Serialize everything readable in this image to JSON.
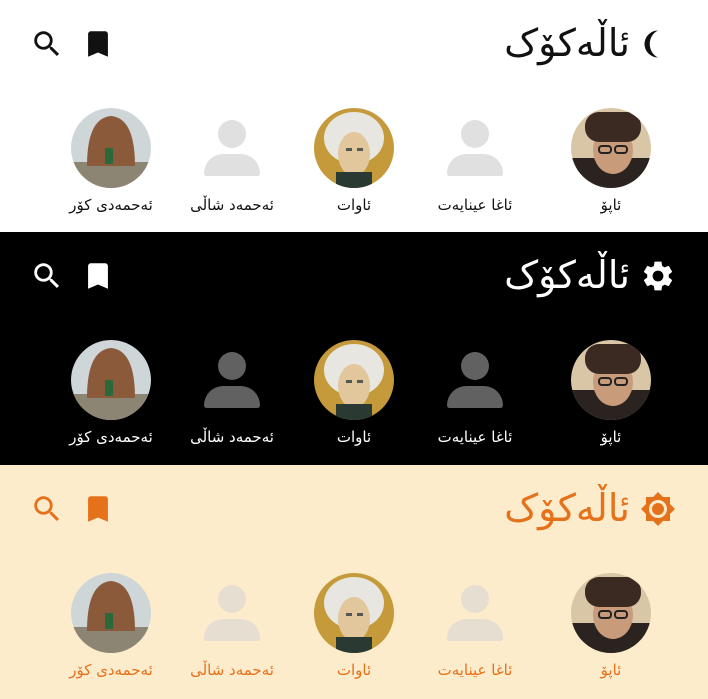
{
  "colors": {
    "light_bg": "#ffffff",
    "dark_bg": "#000000",
    "sepia_bg": "#fdeccc",
    "sepia_accent": "#e5711a"
  },
  "icons": {
    "search": "search-icon",
    "bookmark": "bookmark-icon",
    "theme_light": "moon-icon",
    "theme_dark": "gear-icon",
    "theme_sepia": "sun-icon"
  },
  "panels": [
    {
      "theme": "light",
      "title": "ئاڵەکۆک",
      "people": [
        {
          "name": "ئاپۆ",
          "avatar": "portrait-old-man-fur-hat"
        },
        {
          "name": "ئاغا عینایەت",
          "avatar": "placeholder"
        },
        {
          "name": "ئاوات",
          "avatar": "portrait-white-hair"
        },
        {
          "name": "ئەحمەد شاڵی",
          "avatar": "placeholder"
        },
        {
          "name": "ئەحمەدی کۆر",
          "avatar": "mud-dome-tomb"
        }
      ]
    },
    {
      "theme": "dark",
      "title": "ئاڵەکۆک",
      "people": [
        {
          "name": "ئاپۆ",
          "avatar": "portrait-old-man-fur-hat"
        },
        {
          "name": "ئاغا عینایەت",
          "avatar": "placeholder"
        },
        {
          "name": "ئاوات",
          "avatar": "portrait-white-hair"
        },
        {
          "name": "ئەحمەد شاڵی",
          "avatar": "placeholder"
        },
        {
          "name": "ئەحمەدی کۆر",
          "avatar": "mud-dome-tomb"
        }
      ]
    },
    {
      "theme": "sepia",
      "title": "ئاڵەکۆک",
      "people": [
        {
          "name": "ئاپۆ",
          "avatar": "portrait-old-man-fur-hat"
        },
        {
          "name": "ئاغا عینایەت",
          "avatar": "placeholder"
        },
        {
          "name": "ئاوات",
          "avatar": "portrait-white-hair"
        },
        {
          "name": "ئەحمەد شاڵی",
          "avatar": "placeholder"
        },
        {
          "name": "ئەحمەدی کۆر",
          "avatar": "mud-dome-tomb"
        }
      ]
    }
  ]
}
